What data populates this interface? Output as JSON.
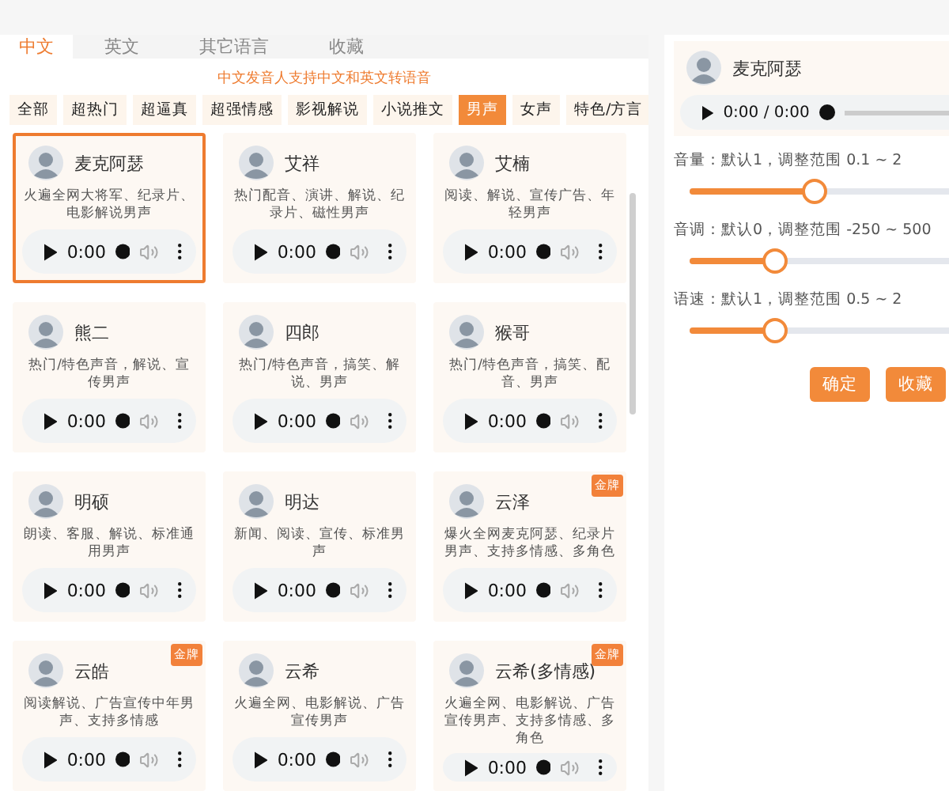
{
  "tabs": [
    {
      "label": "中文",
      "selected": true
    },
    {
      "label": "英文",
      "selected": false
    },
    {
      "label": "其它语言",
      "selected": false
    },
    {
      "label": "收藏",
      "selected": false
    }
  ],
  "notice": "中文发音人支持中文和英文转语音",
  "filters": [
    {
      "label": "全部",
      "selected": false
    },
    {
      "label": "超热门",
      "selected": false
    },
    {
      "label": "超逼真",
      "selected": false
    },
    {
      "label": "超强情感",
      "selected": false
    },
    {
      "label": "影视解说",
      "selected": false
    },
    {
      "label": "小说推文",
      "selected": false
    },
    {
      "label": "男声",
      "selected": true
    },
    {
      "label": "女声",
      "selected": false
    },
    {
      "label": "特色/方言",
      "selected": false
    }
  ],
  "voices": [
    {
      "name": "麦克阿瑟",
      "description": "火遍全网大将军、纪录片、电影解说男声",
      "time": "0:00",
      "selected": true
    },
    {
      "name": "艾祥",
      "description": "热门配音、演讲、解说、纪录片、磁性男声",
      "time": "0:00",
      "selected": false
    },
    {
      "name": "艾楠",
      "description": "阅读、解说、宣传广告、年轻男声",
      "time": "0:00",
      "selected": false
    },
    {
      "name": "熊二",
      "description": "热门/特色声音，解说、宣传男声",
      "time": "0:00",
      "selected": false
    },
    {
      "name": "四郎",
      "description": "热门/特色声音，搞笑、解说、男声",
      "time": "0:00",
      "selected": false
    },
    {
      "name": "猴哥",
      "description": "热门/特色声音，搞笑、配音、男声",
      "time": "0:00",
      "selected": false
    },
    {
      "name": "明硕",
      "description": "朗读、客服、解说、标准通用男声",
      "time": "0:00",
      "selected": false
    },
    {
      "name": "明达",
      "description": "新闻、阅读、宣传、标准男声",
      "time": "0:00",
      "selected": false
    },
    {
      "name": "云泽",
      "description": "爆火全网麦克阿瑟、纪录片男声、支持多情感、多角色",
      "time": "0:00",
      "selected": false,
      "badge": "金牌"
    },
    {
      "name": "云皓",
      "description": "阅读解说、广告宣传中年男声、支持多情感",
      "time": "0:00",
      "selected": false,
      "badge": "金牌"
    },
    {
      "name": "云希",
      "description": "火遍全网、电影解说、广告宣传男声",
      "time": "0:00",
      "selected": false
    },
    {
      "name": "云希(多情感)",
      "description": "火遍全网、电影解说、广告宣传男声、支持多情感、多角色",
      "time": "0:00",
      "selected": false,
      "badge": "金牌"
    }
  ],
  "detail": {
    "name": "麦克阿瑟",
    "time": "0:00 / 0:00",
    "sliders": [
      {
        "label": "音量：默认1，调整范围 0.1 ~ 2",
        "level": 0.48
      },
      {
        "label": "音调：默认0，调整范围 -250 ~ 500",
        "level": 0.33
      },
      {
        "label": "语速：默认1，调整范围 0.5 ~ 2",
        "level": 0.33
      }
    ],
    "buttons": [
      "确定",
      "收藏"
    ]
  }
}
